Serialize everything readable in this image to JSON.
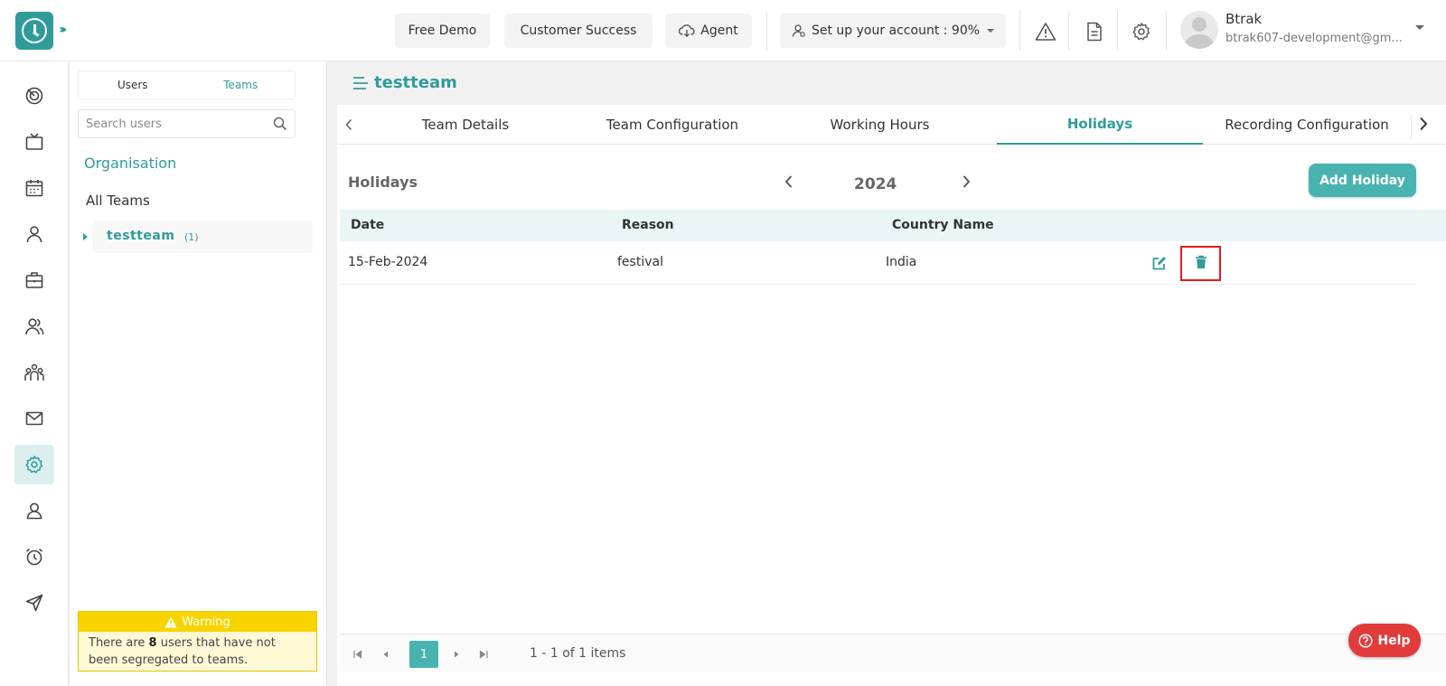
{
  "header": {
    "free_demo": "Free Demo",
    "customer_success": "Customer Success",
    "agent": "Agent",
    "setup_account": "Set up your account : 90%",
    "user_name": "Btrak",
    "user_email": "btrak607-development@gm..."
  },
  "panel": {
    "toggle_users": "Users",
    "toggle_teams": "Teams",
    "search_placeholder": "Search users",
    "organisation": "Organisation",
    "all_teams": "All Teams",
    "team_name": "testteam",
    "team_count": "(1)",
    "warning_title": "Warning",
    "warning_prefix": "There are ",
    "warning_count": "8",
    "warning_suffix": " users that have not been segregated to teams."
  },
  "main": {
    "team_title": "testteam",
    "tabs": [
      {
        "label": "Team Details"
      },
      {
        "label": "Team Configuration"
      },
      {
        "label": "Working Hours"
      },
      {
        "label": "Holidays"
      },
      {
        "label": "Recording Configuration"
      }
    ],
    "section_title": "Holidays",
    "year": "2024",
    "add_button": "Add Holiday",
    "columns": {
      "date": "Date",
      "reason": "Reason",
      "country": "Country Name"
    },
    "rows": [
      {
        "date": "15-Feb-2024",
        "reason": "festival",
        "country": "India"
      }
    ],
    "pager": {
      "page": "1",
      "info": "1 - 1 of 1 items"
    }
  },
  "help_label": "Help",
  "colors": {
    "accent": "#2f9c9a",
    "button": "#49b3b1",
    "highlight_border": "#e21c1c",
    "help": "#e23b3b",
    "warning": "#f7d400"
  }
}
